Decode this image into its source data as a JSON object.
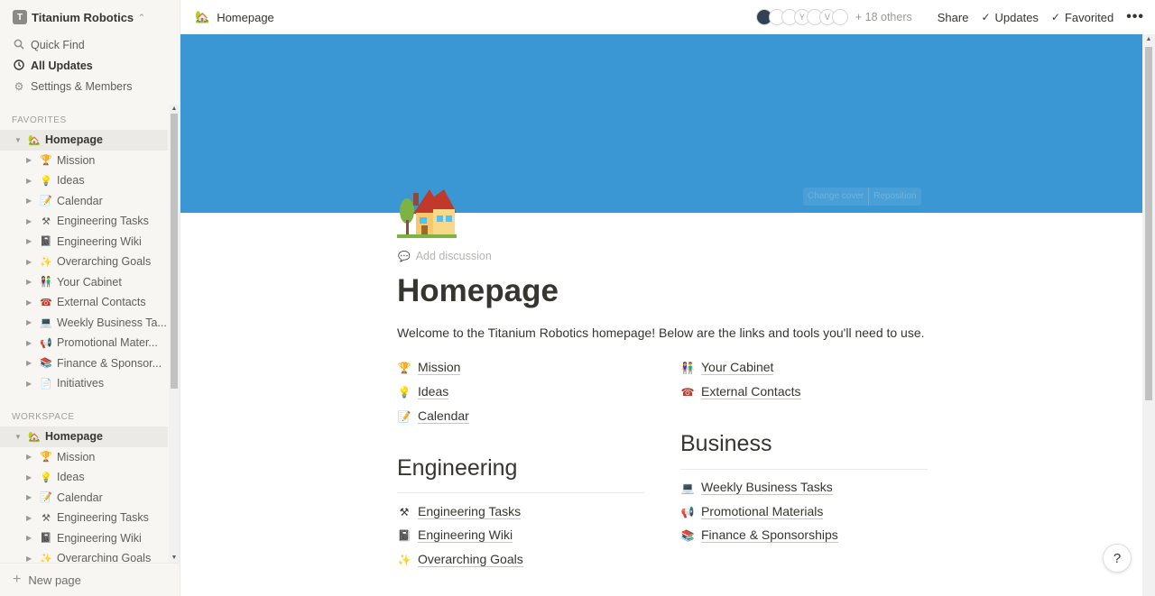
{
  "workspace": {
    "name": "Titanium Robotics",
    "logo": "T"
  },
  "sidebar": {
    "nav": [
      {
        "label": "Quick Find",
        "icon": "search-icon"
      },
      {
        "label": "All Updates",
        "icon": "clock-icon"
      },
      {
        "label": "Settings & Members",
        "icon": "gear-icon"
      }
    ],
    "favorites_label": "FAVORITES",
    "workspace_label": "WORKSPACE",
    "favorites": [
      {
        "label": "Homepage",
        "emoji": "🏡"
      },
      {
        "label": "Mission",
        "emoji": "🏆"
      },
      {
        "label": "Ideas",
        "emoji": "💡"
      },
      {
        "label": "Calendar",
        "emoji": "📝"
      },
      {
        "label": "Engineering Tasks",
        "emoji": "⚒"
      },
      {
        "label": "Engineering Wiki",
        "emoji": "📓"
      },
      {
        "label": "Overarching Goals",
        "emoji": "✨"
      },
      {
        "label": "Your Cabinet",
        "emoji": "👫"
      },
      {
        "label": "External Contacts",
        "emoji": "☎"
      },
      {
        "label": "Weekly Business Ta...",
        "emoji": "💻"
      },
      {
        "label": "Promotional Mater...",
        "emoji": "📢"
      },
      {
        "label": "Finance & Sponsor...",
        "emoji": "📚"
      },
      {
        "label": "Initiatives",
        "emoji": "📄"
      }
    ],
    "workspace_items": [
      {
        "label": "Homepage",
        "emoji": "🏡"
      },
      {
        "label": "Mission",
        "emoji": "🏆"
      },
      {
        "label": "Ideas",
        "emoji": "💡"
      },
      {
        "label": "Calendar",
        "emoji": "📝"
      },
      {
        "label": "Engineering Tasks",
        "emoji": "⚒"
      },
      {
        "label": "Engineering Wiki",
        "emoji": "📓"
      },
      {
        "label": "Overarching Goals",
        "emoji": "✨"
      }
    ],
    "new_page": "New page"
  },
  "topbar": {
    "breadcrumb": "Homepage",
    "breadcrumb_emoji": "🏡",
    "avatar_letters": [
      "",
      "",
      "",
      "Y",
      "",
      "V",
      ""
    ],
    "others": "+ 18 others",
    "share": "Share",
    "updates": "Updates",
    "favorited": "Favorited",
    "more": "•••"
  },
  "cover": {
    "color": "#3b97d3",
    "change_cover": "Change cover",
    "reposition": "Reposition"
  },
  "page": {
    "add_discussion": "Add discussion",
    "title": "Homepage",
    "welcome": "Welcome to the Titanium Robotics homepage! Below are the links and tools you'll need to use.",
    "left_links": [
      {
        "label": "Mission",
        "emoji": "🏆"
      },
      {
        "label": "Ideas",
        "emoji": "💡"
      },
      {
        "label": "Calendar",
        "emoji": "📝"
      }
    ],
    "right_links": [
      {
        "label": "Your Cabinet",
        "emoji": "👫"
      },
      {
        "label": "External Contacts",
        "emoji": "☎"
      }
    ],
    "engineering_heading": "Engineering",
    "engineering_links": [
      {
        "label": "Engineering Tasks",
        "emoji": "⚒"
      },
      {
        "label": "Engineering Wiki",
        "emoji": "📓"
      },
      {
        "label": "Overarching Goals",
        "emoji": "✨"
      }
    ],
    "business_heading": "Business",
    "business_links": [
      {
        "label": "Weekly Business Tasks",
        "emoji": "💻"
      },
      {
        "label": "Promotional Materials",
        "emoji": "📢"
      },
      {
        "label": "Finance & Sponsorships",
        "emoji": "📚"
      }
    ]
  },
  "help_label": "?"
}
